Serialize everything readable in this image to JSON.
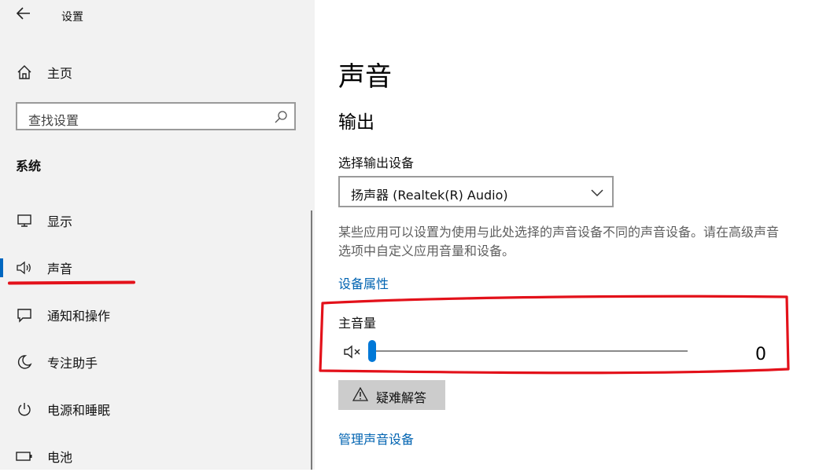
{
  "window": {
    "title": "设置",
    "back_icon": "back-arrow-icon"
  },
  "sidebar": {
    "home_label": "主页",
    "search_placeholder": "查找设置",
    "section_title": "系统",
    "items": [
      {
        "label": "显示",
        "icon": "monitor-icon"
      },
      {
        "label": "声音",
        "icon": "speaker-icon",
        "active": true
      },
      {
        "label": "通知和操作",
        "icon": "notification-icon"
      },
      {
        "label": "专注助手",
        "icon": "moon-icon"
      },
      {
        "label": "电源和睡眠",
        "icon": "power-icon"
      },
      {
        "label": "电池",
        "icon": "battery-icon"
      }
    ]
  },
  "main": {
    "title": "声音",
    "output_heading": "输出",
    "output_device_label": "选择输出设备",
    "output_device_value": "扬声器 (Realtek(R) Audio)",
    "description": "某些应用可以设置为使用与此处选择的声音设备不同的声音设备。请在高级声音选项中自定义应用音量和设备。",
    "device_properties_link": "设备属性",
    "master_volume_label": "主音量",
    "master_volume_value": "0",
    "troubleshoot_label": "疑难解答",
    "manage_devices_link": "管理声音设备"
  },
  "colors": {
    "accent": "#0078d7",
    "link": "#0063b1",
    "annotation": "#e3111a"
  }
}
